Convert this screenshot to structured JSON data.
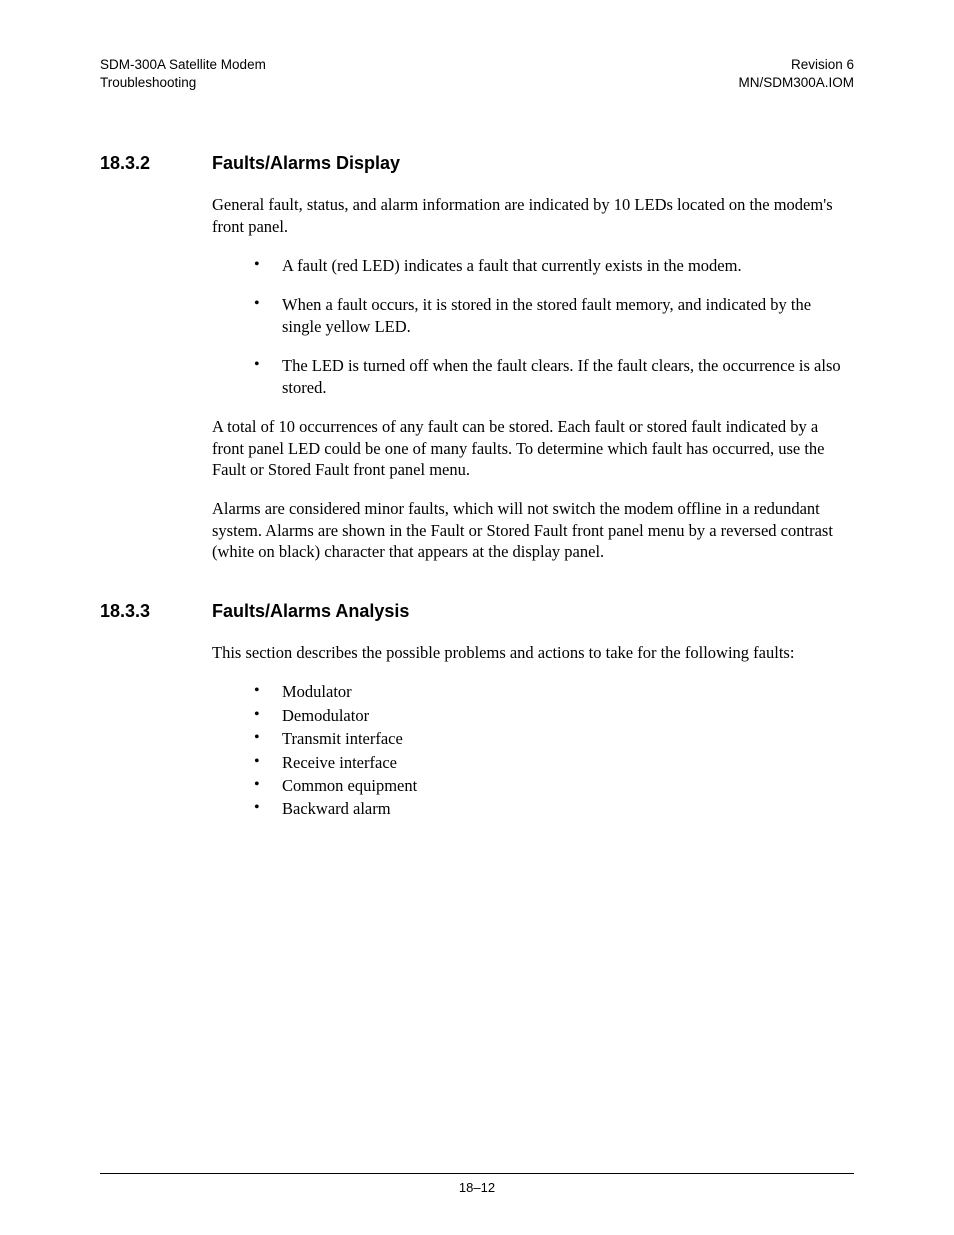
{
  "header": {
    "left_line1": "SDM-300A Satellite Modem",
    "left_line2": "Troubleshooting",
    "right_line1": "Revision 6",
    "right_line2": "MN/SDM300A.IOM"
  },
  "sections": {
    "s1": {
      "number": "18.3.2",
      "title": "Faults/Alarms Display",
      "intro": "General fault, status, and alarm information are indicated by 10 LEDs located on the modem's front panel.",
      "bullets": [
        "A fault (red LED) indicates a fault that currently exists in the modem.",
        "When a fault occurs, it is stored in the stored fault memory, and indicated by the single yellow LED.",
        "The LED is turned off when the fault clears. If the fault clears, the occurrence is also stored."
      ],
      "after1": "A total of 10 occurrences of any fault can be stored. Each fault or stored fault indicated by a front panel LED could be one of many faults. To determine which fault has occurred, use the Fault or Stored Fault front panel menu.",
      "after2": "Alarms are considered minor faults, which will not switch the modem offline in a redundant system. Alarms are shown in the Fault or Stored Fault front panel menu by a reversed contrast (white on black) character that appears at the display panel."
    },
    "s2": {
      "number": "18.3.3",
      "title": "Faults/Alarms Analysis",
      "intro": "This section describes the possible problems and actions to take for the following faults:",
      "bullets": [
        "Modulator",
        "Demodulator",
        "Transmit interface",
        "Receive interface",
        "Common equipment",
        "Backward alarm"
      ]
    }
  },
  "footer": {
    "page": "18–12"
  }
}
